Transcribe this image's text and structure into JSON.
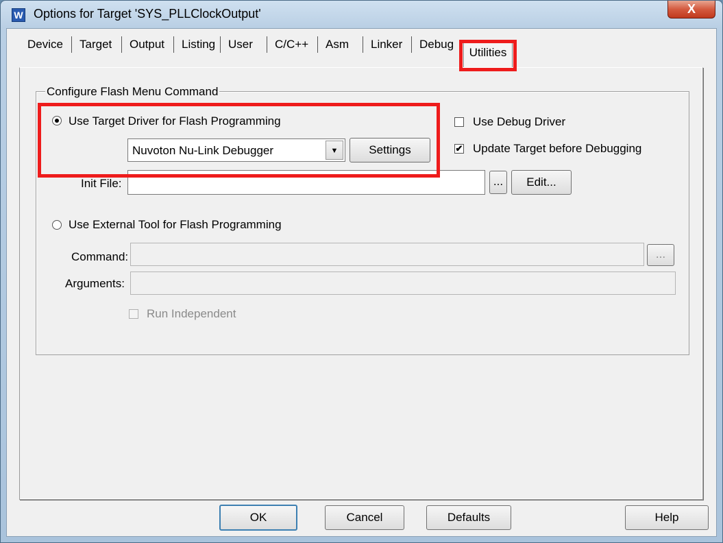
{
  "window": {
    "title": "Options for Target 'SYS_PLLClockOutput'",
    "close_label": "X",
    "app_icon_glyph": "W",
    "icon": "uvision-app-icon"
  },
  "tabs": [
    {
      "label": "Device"
    },
    {
      "label": "Target"
    },
    {
      "label": "Output"
    },
    {
      "label": "Listing"
    },
    {
      "label": "User"
    },
    {
      "label": "C/C++"
    },
    {
      "label": "Asm"
    },
    {
      "label": "Linker"
    },
    {
      "label": "Debug"
    },
    {
      "label": "Utilities",
      "active": true
    }
  ],
  "flash_group": {
    "legend": "Configure Flash Menu Command",
    "use_target_driver": {
      "label": "Use Target Driver for Flash Programming",
      "selected": true
    },
    "driver_select": {
      "value": "Nuvoton Nu-Link Debugger"
    },
    "settings_button": "Settings",
    "use_debug_driver": {
      "label": "Use Debug Driver",
      "checked": false
    },
    "update_target": {
      "label": "Update Target before Debugging",
      "checked": true
    },
    "init_file": {
      "label": "Init File:",
      "value": ""
    },
    "browse_button": "...",
    "edit_button": "Edit...",
    "use_external_tool": {
      "label": "Use External Tool for Flash Programming",
      "selected": false
    },
    "command": {
      "label": "Command:",
      "value": ""
    },
    "command_browse_button": "...",
    "arguments": {
      "label": "Arguments:",
      "value": ""
    },
    "run_independent": {
      "label": "Run Independent",
      "checked": false,
      "disabled": true
    }
  },
  "footer": {
    "ok": "OK",
    "cancel": "Cancel",
    "defaults": "Defaults",
    "help": "Help"
  },
  "colors": {
    "highlight": "#ee1c1c"
  }
}
